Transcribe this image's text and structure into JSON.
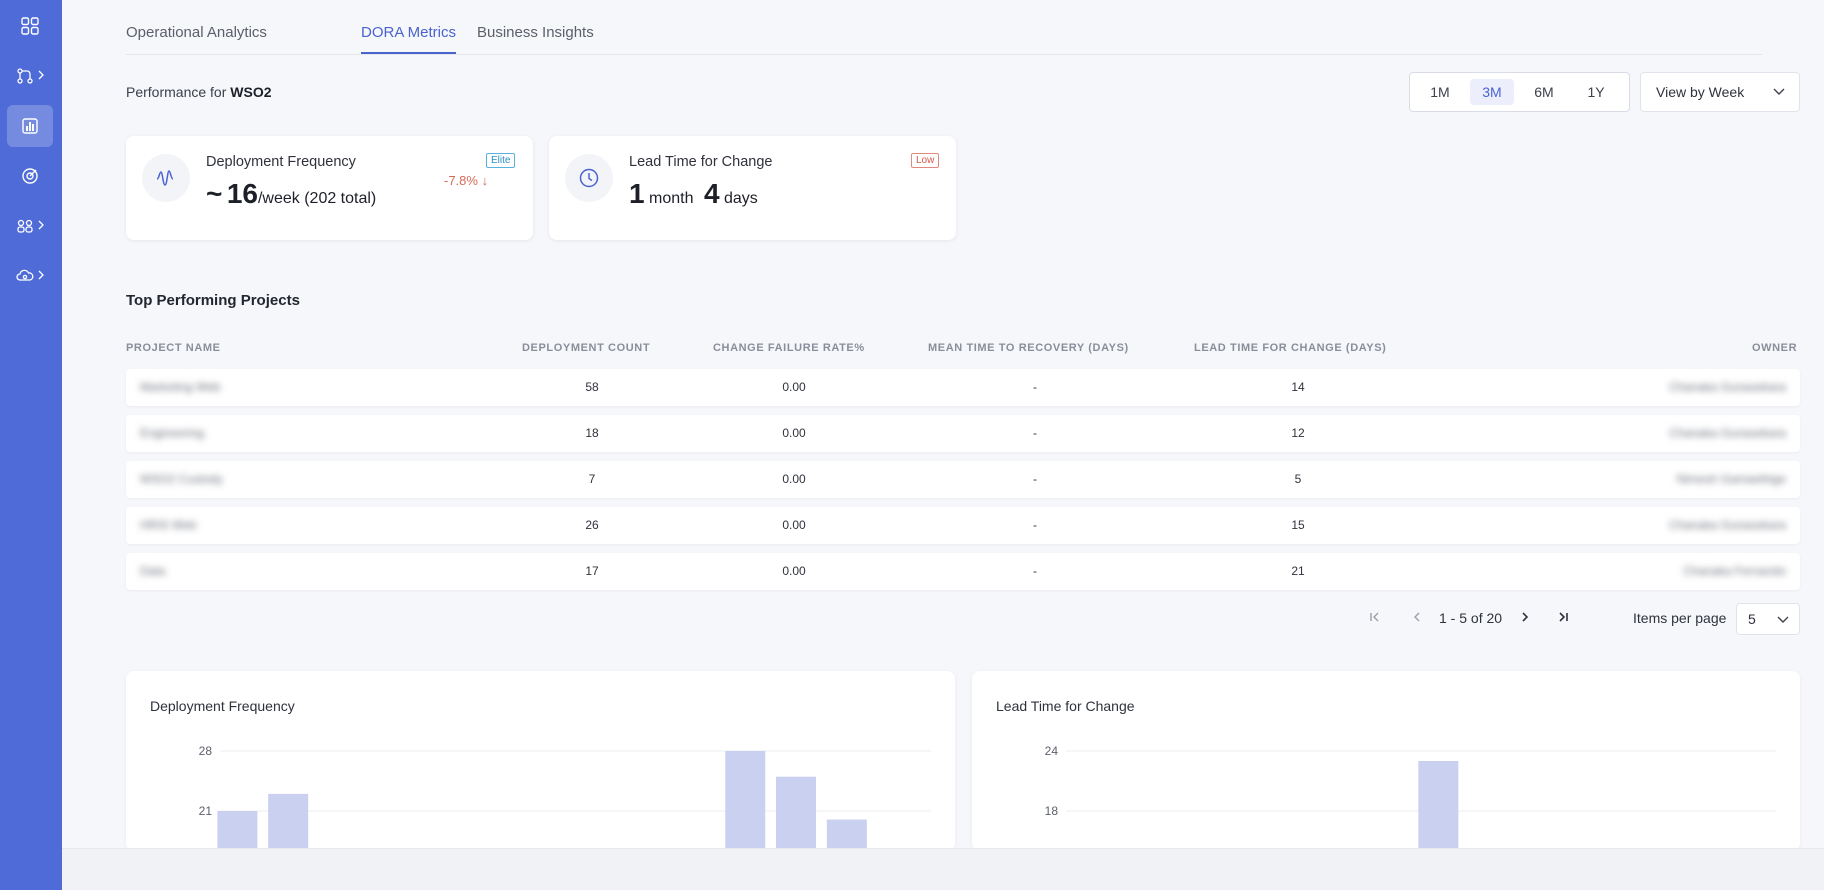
{
  "tabs": [
    {
      "label": "Operational Analytics",
      "active": false
    },
    {
      "label": "DORA Metrics",
      "active": true
    },
    {
      "label": "Business Insights",
      "active": false
    }
  ],
  "performance": {
    "prefix": "Performance for",
    "org": "WSO2"
  },
  "ranges": [
    {
      "label": "1M",
      "active": false
    },
    {
      "label": "3M",
      "active": true
    },
    {
      "label": "6M",
      "active": false
    },
    {
      "label": "1Y",
      "active": false
    }
  ],
  "view_select": {
    "value": "View by Week"
  },
  "kpis": {
    "deployment": {
      "title": "Deployment Frequency",
      "badge": "Elite",
      "prefix": "~",
      "value": "16",
      "suffix": "/week (202 total)",
      "change": "-7.8% ↓"
    },
    "lead_time": {
      "title": "Lead Time for Change",
      "badge": "Low",
      "v1": "1",
      "u1": "month",
      "v2": "4",
      "u2": "days"
    }
  },
  "table": {
    "title": "Top Performing Projects",
    "headers": {
      "project": "PROJECT NAME",
      "deployments": "DEPLOYMENT COUNT",
      "cfr": "CHANGE FAILURE RATE%",
      "mttr": "MEAN TIME TO RECOVERY (DAYS)",
      "lead": "LEAD TIME FOR CHANGE (DAYS)",
      "owner": "OWNER"
    },
    "rows": [
      {
        "project": "Marketing Web",
        "deployments": "58",
        "cfr": "0.00",
        "mttr": "-",
        "lead": "14",
        "owner": "Chanaka Gunasekara"
      },
      {
        "project": "Engineering",
        "deployments": "18",
        "cfr": "0.00",
        "mttr": "-",
        "lead": "12",
        "owner": "Chanaka Gunasekara"
      },
      {
        "project": "WSO2 Custody",
        "deployments": "7",
        "cfr": "0.00",
        "mttr": "-",
        "lead": "5",
        "owner": "Nimesh Gamaethige"
      },
      {
        "project": "HRIS Web",
        "deployments": "26",
        "cfr": "0.00",
        "mttr": "-",
        "lead": "15",
        "owner": "Chanaka Gunasekara"
      },
      {
        "project": "Data",
        "deployments": "17",
        "cfr": "0.00",
        "mttr": "-",
        "lead": "21",
        "owner": "Chanaka Fernando"
      }
    ]
  },
  "pagination": {
    "range": "1 - 5 of 20",
    "items_label": "Items per page",
    "items_value": "5"
  },
  "chart_data": [
    {
      "type": "bar",
      "title": "Deployment Frequency",
      "yticks": [
        21,
        28
      ],
      "ylim": [
        12,
        29
      ],
      "values": [
        21,
        23,
        0,
        0,
        0,
        0,
        0,
        0,
        0,
        0,
        28,
        25,
        20,
        0
      ],
      "bar_color": "#c9d0f0"
    },
    {
      "type": "bar",
      "title": "Lead Time for Change",
      "yticks": [
        18,
        24
      ],
      "ylim": [
        10,
        25
      ],
      "values": [
        0,
        0,
        0,
        0,
        0,
        0,
        0,
        23,
        0,
        0,
        0,
        0,
        0,
        0
      ],
      "bar_color": "#c9d0f0"
    }
  ]
}
